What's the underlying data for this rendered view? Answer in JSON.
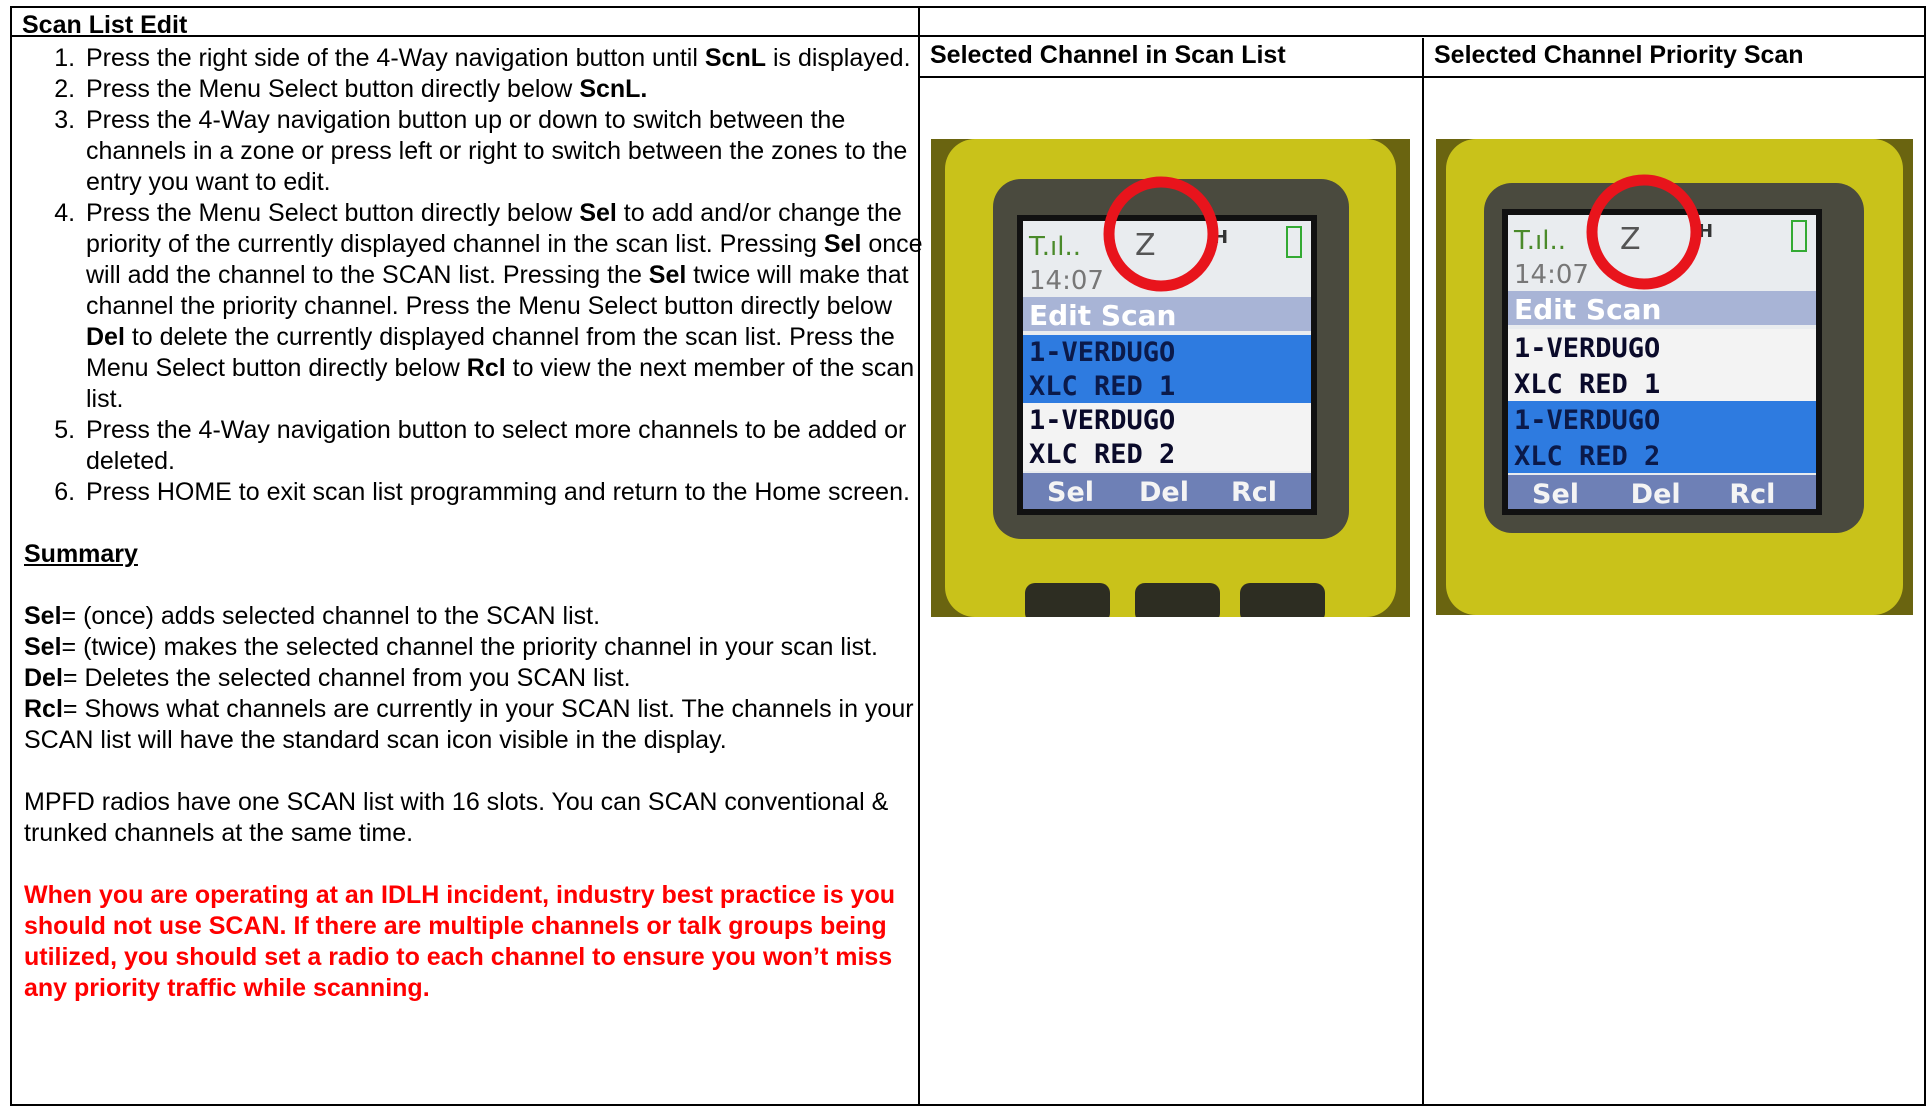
{
  "title": "Scan List Edit",
  "steps": [
    [
      "Press the right side of the 4-Way navigation button until ",
      {
        "b": "ScnL"
      },
      " is displayed."
    ],
    [
      "Press the Menu Select button directly below ",
      {
        "b": "ScnL."
      }
    ],
    [
      "Press the 4-Way navigation button up or down to switch between the channels in a zone or press left or right to switch between the zones to the entry you want to edit."
    ],
    [
      "Press the Menu Select button directly below ",
      {
        "b": "Sel"
      },
      " to add and/or change the priority of the currently displayed channel in the scan list. Pressing ",
      {
        "b": "Sel"
      },
      " once will add the channel to the SCAN list. Pressing the ",
      {
        "b": "Sel"
      },
      " twice will make that channel the priority channel. Press the Menu Select button directly below ",
      {
        "b": "Del"
      },
      " to delete the currently displayed channel from the scan list. Press the Menu Select button directly below ",
      {
        "b": "Rcl"
      },
      " to view the next member of the scan list."
    ],
    [
      "Press the 4-Way navigation button to select more channels to be added or deleted."
    ],
    [
      "Press HOME to exit scan list programming and return to the Home screen."
    ]
  ],
  "summary": {
    "heading": "Summary",
    "items": [
      {
        "key": "Sel",
        "text": "= (once) adds selected channel to the SCAN list."
      },
      {
        "key": "Sel",
        "text": "= (twice) makes the selected channel the priority channel in your scan list."
      },
      {
        "key": "Del",
        "text": "= Deletes the selected channel from you SCAN list."
      },
      {
        "key": "Rcl",
        "text": "= Shows what channels are currently in your SCAN list. The channels in your SCAN list will have the standard scan icon visible in the display."
      }
    ],
    "note": "MPFD radios have one SCAN list with 16 slots. You can SCAN conventional & trunked channels at the same time.",
    "warning": "When you are operating at an IDLH incident, industry best practice is you should not use SCAN. If there are multiple channels or talk groups being utilized, you should set a radio to each channel to ensure you won’t miss any priority traffic while scanning."
  },
  "columns": {
    "col1_header": "Selected Channel in Scan List",
    "col2_header": "Selected Channel Priority Scan"
  },
  "screen1": {
    "time": "14:07",
    "zone": "Z",
    "h": "H",
    "header": "Edit Scan",
    "rows": [
      "1-VERDUGO",
      "XLC RED 1",
      "1-VERDUGO",
      "XLC RED 2"
    ],
    "highlighted": [
      0,
      1
    ],
    "softkeys": [
      "Sel",
      "Del",
      "Rcl"
    ]
  },
  "screen2": {
    "time": "14:07",
    "zone": "Z",
    "h": "H",
    "header": "Edit Scan",
    "rows": [
      "1-VERDUGO",
      "XLC RED 1",
      "1-VERDUGO",
      "XLC RED 2"
    ],
    "highlighted": [
      2,
      3
    ],
    "softkeys": [
      "Sel",
      "Del",
      "Rcl"
    ]
  },
  "colors": {
    "warning": "#ff0000",
    "highlight": "#2e7be0",
    "radio_body": "#c9c21a",
    "circle": "#e8141c"
  }
}
